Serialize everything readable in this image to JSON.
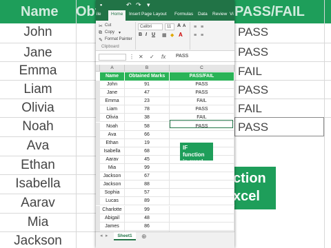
{
  "background": {
    "headers": [
      "Name",
      "Obtai",
      "PASS/FAIL"
    ],
    "names": [
      "John",
      "Jane",
      "Emma",
      "Liam",
      "Olivia",
      "Noah",
      "Ava",
      "Ethan",
      "Isabella",
      "Aarav",
      "Mia",
      "Jackson"
    ],
    "results": [
      "PASS",
      "PASS",
      "FAIL",
      "PASS",
      "FAIL",
      "PASS"
    ],
    "overlay_text_1": "ction",
    "overlay_text_2": "xcel"
  },
  "excel": {
    "tabs": [
      "ile",
      "Home",
      "Insert",
      "Page Layout",
      "Formulas",
      "Data",
      "Review",
      "Vi"
    ],
    "active_tab": "Home",
    "clipboard": {
      "cut": "Cut",
      "copy": "Copy",
      "format_painter": "Format Painter",
      "group_label": "Clipboard"
    },
    "font": {
      "name": "Calibri",
      "size": "11",
      "bold": "B",
      "italic": "I",
      "underline": "U",
      "grow": "A",
      "shrink": "A"
    },
    "formula_bar": {
      "cancel": "✕",
      "enter": "✓",
      "fx": "fx",
      "value": "PASS"
    },
    "columns": [
      "A",
      "B",
      "C"
    ],
    "table_headers": [
      "Name",
      "Obtained Marks",
      "PASS/FAIL"
    ],
    "rows": [
      {
        "name": "John",
        "marks": "91",
        "result": "PASS"
      },
      {
        "name": "Jane",
        "marks": "47",
        "result": "PASS"
      },
      {
        "name": "Emma",
        "marks": "23",
        "result": "FAIL"
      },
      {
        "name": "Liam",
        "marks": "78",
        "result": "PASS"
      },
      {
        "name": "Olivia",
        "marks": "38",
        "result": "FAIL"
      },
      {
        "name": "Noah",
        "marks": "58",
        "result": "PASS"
      },
      {
        "name": "Ava",
        "marks": "66",
        "result": ""
      },
      {
        "name": "Ethan",
        "marks": "19",
        "result": ""
      },
      {
        "name": "Isabella",
        "marks": "68",
        "result": ""
      },
      {
        "name": "Aarav",
        "marks": "45",
        "result": ""
      },
      {
        "name": "Mia",
        "marks": "99",
        "result": ""
      },
      {
        "name": "Jackson",
        "marks": "67",
        "result": ""
      },
      {
        "name": "Jackson",
        "marks": "88",
        "result": ""
      },
      {
        "name": "Sophia",
        "marks": "57",
        "result": ""
      },
      {
        "name": "Lucas",
        "marks": "89",
        "result": ""
      },
      {
        "name": "Charlotte",
        "marks": "99",
        "result": ""
      },
      {
        "name": "Abigail",
        "marks": "48",
        "result": ""
      },
      {
        "name": "James",
        "marks": "86",
        "result": ""
      },
      {
        "name": "William",
        "marks": "59",
        "result": ""
      }
    ],
    "badge": "IF function in excel",
    "sheet_tab": "Sheet1",
    "add_sheet": "⊕"
  }
}
